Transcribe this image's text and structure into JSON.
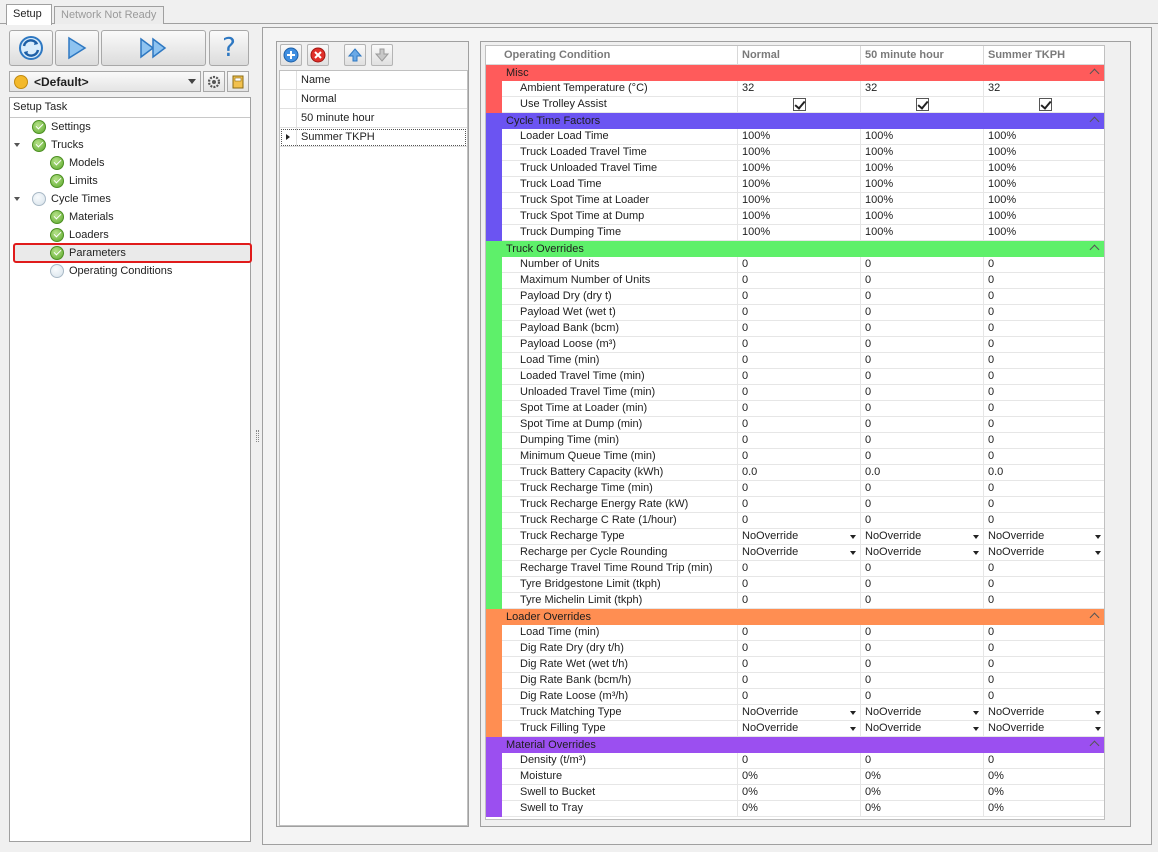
{
  "tabs": [
    "Setup",
    "Network Not Ready"
  ],
  "profile": "<Default>",
  "setup_task": {
    "header": "Setup Task",
    "items": [
      {
        "label": "Settings",
        "status": "ok",
        "level": 0
      },
      {
        "label": "Trucks",
        "status": "ok",
        "level": 0
      },
      {
        "label": "Models",
        "status": "ok",
        "level": 1
      },
      {
        "label": "Limits",
        "status": "ok",
        "level": 1
      },
      {
        "label": "Cycle Times",
        "status": "empty",
        "level": 0
      },
      {
        "label": "Materials",
        "status": "ok",
        "level": 1
      },
      {
        "label": "Loaders",
        "status": "ok",
        "level": 1
      },
      {
        "label": "Parameters",
        "status": "ok",
        "level": 1
      },
      {
        "label": "Operating Conditions",
        "status": "empty",
        "level": 1
      }
    ]
  },
  "conditions": {
    "header": "Name",
    "rows": [
      "Normal",
      "50 minute hour",
      "Summer TKPH"
    ],
    "selected": 2
  },
  "grid": {
    "columns": [
      "Operating Condition",
      "Normal",
      "50 minute hour",
      "Summer TKPH"
    ],
    "categories": [
      {
        "name": "Misc",
        "color": "#ff5b5b",
        "rows": [
          {
            "label": "Ambient Temperature (°C)",
            "values": [
              "32",
              "32",
              "32"
            ]
          },
          {
            "label": "Use Trolley Assist",
            "checkbox": true
          }
        ]
      },
      {
        "name": "Cycle Time Factors",
        "color": "#6b54f2",
        "rows": [
          {
            "label": "Loader Load Time",
            "values": [
              "100%",
              "100%",
              "100%"
            ]
          },
          {
            "label": "Truck Loaded Travel Time",
            "values": [
              "100%",
              "100%",
              "100%"
            ]
          },
          {
            "label": "Truck Unloaded Travel Time",
            "values": [
              "100%",
              "100%",
              "100%"
            ]
          },
          {
            "label": "Truck Load Time",
            "values": [
              "100%",
              "100%",
              "100%"
            ]
          },
          {
            "label": "Truck Spot Time at Loader",
            "values": [
              "100%",
              "100%",
              "100%"
            ]
          },
          {
            "label": "Truck Spot Time at Dump",
            "values": [
              "100%",
              "100%",
              "100%"
            ]
          },
          {
            "label": "Truck Dumping Time",
            "values": [
              "100%",
              "100%",
              "100%"
            ]
          }
        ]
      },
      {
        "name": "Truck Overrides",
        "color": "#5ef06a",
        "rows": [
          {
            "label": "Number of Units",
            "values": [
              "0",
              "0",
              "0"
            ]
          },
          {
            "label": "Maximum Number of Units",
            "values": [
              "0",
              "0",
              "0"
            ]
          },
          {
            "label": "Payload Dry (dry t)",
            "values": [
              "0",
              "0",
              "0"
            ]
          },
          {
            "label": "Payload Wet (wet t)",
            "values": [
              "0",
              "0",
              "0"
            ]
          },
          {
            "label": "Payload Bank (bcm)",
            "values": [
              "0",
              "0",
              "0"
            ]
          },
          {
            "label": "Payload Loose (m³)",
            "values": [
              "0",
              "0",
              "0"
            ]
          },
          {
            "label": "Load Time (min)",
            "values": [
              "0",
              "0",
              "0"
            ]
          },
          {
            "label": "Loaded Travel Time (min)",
            "values": [
              "0",
              "0",
              "0"
            ]
          },
          {
            "label": "Unloaded Travel Time (min)",
            "values": [
              "0",
              "0",
              "0"
            ]
          },
          {
            "label": "Spot Time at Loader (min)",
            "values": [
              "0",
              "0",
              "0"
            ]
          },
          {
            "label": "Spot Time at Dump (min)",
            "values": [
              "0",
              "0",
              "0"
            ]
          },
          {
            "label": "Dumping Time (min)",
            "values": [
              "0",
              "0",
              "0"
            ]
          },
          {
            "label": "Minimum Queue Time (min)",
            "values": [
              "0",
              "0",
              "0"
            ]
          },
          {
            "label": "Truck Battery Capacity (kWh)",
            "values": [
              "0.0",
              "0.0",
              "0.0"
            ]
          },
          {
            "label": "Truck Recharge Time (min)",
            "values": [
              "0",
              "0",
              "0"
            ]
          },
          {
            "label": "Truck Recharge Energy Rate (kW)",
            "values": [
              "0",
              "0",
              "0"
            ]
          },
          {
            "label": "Truck Recharge C Rate (1/hour)",
            "values": [
              "0",
              "0",
              "0"
            ]
          },
          {
            "label": "Truck Recharge Type",
            "values": [
              "NoOverride",
              "NoOverride",
              "NoOverride"
            ],
            "dropdown": true
          },
          {
            "label": "Recharge per Cycle Rounding",
            "values": [
              "NoOverride",
              "NoOverride",
              "NoOverride"
            ],
            "dropdown": true
          },
          {
            "label": "Recharge Travel Time Round Trip (min)",
            "values": [
              "0",
              "0",
              "0"
            ]
          },
          {
            "label": "Tyre Bridgestone Limit (tkph)",
            "values": [
              "0",
              "0",
              "0"
            ]
          },
          {
            "label": "Tyre Michelin Limit (tkph)",
            "values": [
              "0",
              "0",
              "0"
            ]
          }
        ]
      },
      {
        "name": "Loader Overrides",
        "color": "#ff8e52",
        "rows": [
          {
            "label": "Load Time (min)",
            "values": [
              "0",
              "0",
              "0"
            ]
          },
          {
            "label": "Dig Rate Dry (dry t/h)",
            "values": [
              "0",
              "0",
              "0"
            ]
          },
          {
            "label": "Dig Rate Wet (wet t/h)",
            "values": [
              "0",
              "0",
              "0"
            ]
          },
          {
            "label": "Dig Rate Bank (bcm/h)",
            "values": [
              "0",
              "0",
              "0"
            ]
          },
          {
            "label": "Dig Rate Loose (m³/h)",
            "values": [
              "0",
              "0",
              "0"
            ]
          },
          {
            "label": "Truck Matching Type",
            "values": [
              "NoOverride",
              "NoOverride",
              "NoOverride"
            ],
            "dropdown": true
          },
          {
            "label": "Truck Filling Type",
            "values": [
              "NoOverride",
              "NoOverride",
              "NoOverride"
            ],
            "dropdown": true
          }
        ]
      },
      {
        "name": "Material Overrides",
        "color": "#9b4ff0",
        "rows": [
          {
            "label": "Density (t/m³)",
            "values": [
              "0",
              "0",
              "0"
            ]
          },
          {
            "label": "Moisture",
            "values": [
              "0%",
              "0%",
              "0%"
            ]
          },
          {
            "label": "Swell to Bucket",
            "values": [
              "0%",
              "0%",
              "0%"
            ]
          },
          {
            "label": "Swell to Tray",
            "values": [
              "0%",
              "0%",
              "0%"
            ]
          }
        ]
      }
    ]
  }
}
